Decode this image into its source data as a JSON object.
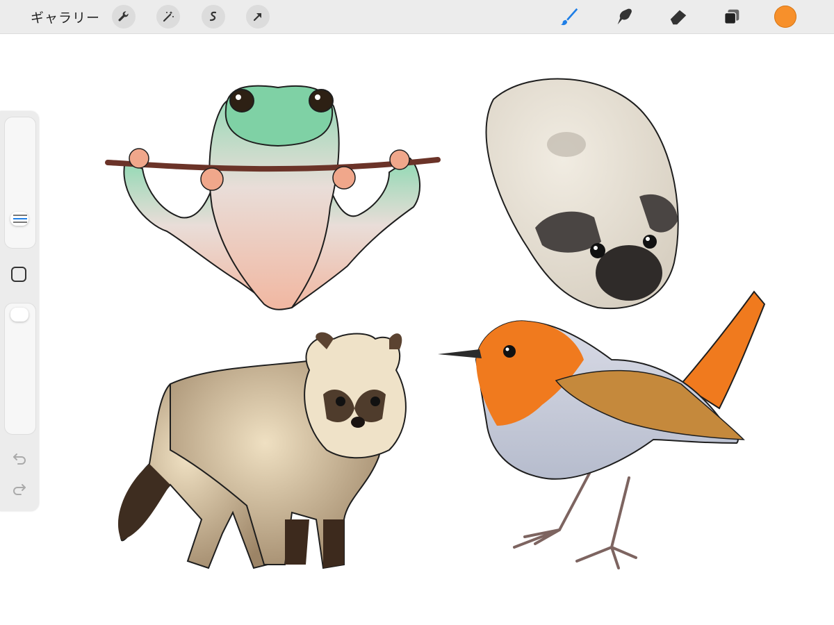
{
  "toolbar": {
    "gallery_label": "ギャラリー",
    "left_tools": [
      "wrench-icon",
      "magic-wand-icon",
      "selection-icon",
      "transform-arrow-icon"
    ],
    "right_tools": [
      "brush-icon",
      "smudge-icon",
      "eraser-icon",
      "layers-icon"
    ],
    "active_tool": "brush-icon",
    "current_color": "#f7902b",
    "accent_color": "#1e7ee6"
  },
  "sidebar": {
    "brush_size_level": 0.4,
    "brush_opacity_level": 1.0,
    "buttons": [
      "modify-square-icon",
      "undo-icon",
      "redo-icon"
    ]
  },
  "canvas": {
    "background": "#ffffff",
    "artwork": [
      "tree-frog",
      "guinea-pig",
      "tanuki",
      "robin"
    ]
  }
}
